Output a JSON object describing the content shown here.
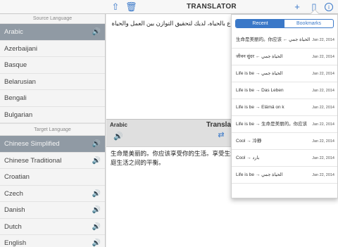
{
  "app": {
    "title": "TRANSLATOR"
  },
  "toolbar": {
    "share_icon": "⇧",
    "trash_icon": "🗑",
    "add_icon": "+",
    "book_icon": "▯",
    "info_icon": "i"
  },
  "source_section": {
    "header": "Source Language"
  },
  "target_section": {
    "header": "Target Language"
  },
  "source_languages": [
    {
      "label": "Arabic",
      "selected": true,
      "speaker": true
    },
    {
      "label": "Azerbaijani",
      "selected": false,
      "speaker": false
    },
    {
      "label": "Basque",
      "selected": false,
      "speaker": false
    },
    {
      "label": "Belarusian",
      "selected": false,
      "speaker": false
    },
    {
      "label": "Bengali",
      "selected": false,
      "speaker": false
    },
    {
      "label": "Bulgarian",
      "selected": false,
      "speaker": false
    }
  ],
  "target_languages": [
    {
      "label": "Chinese Simplified",
      "selected": true,
      "speaker": true
    },
    {
      "label": "Chinese Traditional",
      "selected": false,
      "speaker": true
    },
    {
      "label": "Croatian",
      "selected": false,
      "speaker": false
    },
    {
      "label": "Czech",
      "selected": false,
      "speaker": true
    },
    {
      "label": "Danish",
      "selected": false,
      "speaker": true
    },
    {
      "label": "Dutch",
      "selected": false,
      "speaker": true
    },
    {
      "label": "English",
      "selected": false,
      "speaker": true
    }
  ],
  "source_text": "متاع بالحياة، لديك لتحقيق التوازن بين العمل والحياة",
  "translation_bar": {
    "language": "Arabic",
    "label": "Translat"
  },
  "target_text": "生命是美丽的。你应该享受你的生活。享受生活和家庭生活之间的平衡。",
  "popover": {
    "tabs": [
      {
        "label": "Recent",
        "active": true
      },
      {
        "label": "Bookmarks",
        "active": false
      }
    ],
    "history": [
      {
        "text": "生命是美丽的。你应该 ← الحياة جمي",
        "date": "Jan 22, 2014"
      },
      {
        "text": "जीवन सुंदर ← الحياة جمي",
        "date": "Jan 22, 2014"
      },
      {
        "text": "Life is be → الحياة جمي",
        "date": "Jan 22, 2014"
      },
      {
        "text": "Life is be → Das Leben",
        "date": "Jan 22, 2014"
      },
      {
        "text": "Life is be → Elämä on k",
        "date": "Jan 22, 2014"
      },
      {
        "text": "Life is be → 生命是美丽的。你应该",
        "date": "Jan 22, 2014"
      },
      {
        "text": "Cool → 冷静",
        "date": "Jan 22, 2014"
      },
      {
        "text": "Cool → بارد",
        "date": "Jan 22, 2014"
      },
      {
        "text": "Life is be → الحياة جمي",
        "date": "Jan 22, 2014"
      }
    ]
  }
}
